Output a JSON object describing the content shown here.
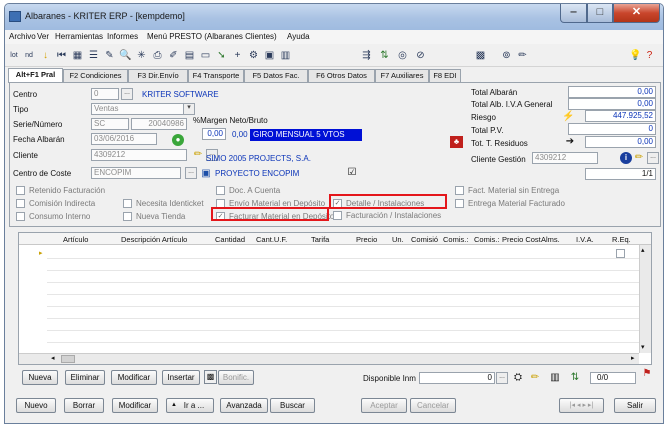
{
  "window": {
    "title": "Albaranes - KRITER ERP - [kempdemo]"
  },
  "menu": [
    "Archivo",
    "Ver",
    "Herramientas",
    "Informes",
    "Menú PRESTO (Albaranes Clientes)",
    "Ayuda"
  ],
  "toolbar": {
    "lot_label": "lot",
    "nd_label": "nd"
  },
  "tabs": [
    "Alt+F1 Pral",
    "F2 Condiciones",
    "F3 Dir.Envío",
    "F4 Transporte",
    "F5 Datos Fac.",
    "F6 Otros Datos",
    "F7 Auxiliares",
    "F8 EDI"
  ],
  "form": {
    "centro_label": "Centro",
    "centro_value": "0",
    "centro_name": "KRITER SOFTWARE",
    "tipo_label": "Tipo",
    "tipo_value": "Ventas",
    "serie_label": "Serie/Número",
    "serie_value": "SC",
    "numero_value": "20040986",
    "margen_label": "%Margen Neto/Bruto",
    "margen_neto": "0,00",
    "margen_bruto": "0,00",
    "forma_pago": "GIRO MENSUAL 5 VTOS",
    "fecha_label": "Fecha Albarán",
    "fecha_value": "03/06/2016",
    "cliente_label": "Cliente",
    "cliente_value": "4309212",
    "cliente_name": "SIMO 2005 PROJECTS, S.A.",
    "coste_label": "Centro de Coste",
    "coste_value": "ENCOPIM",
    "coste_name": "PROYECTO ENCOPIM"
  },
  "totals": {
    "total_albaran_label": "Total Albarán",
    "total_albaran": "0,00",
    "total_iva_label": "Total Alb. I.V.A General",
    "total_iva": "0,00",
    "riesgo_label": "Riesgo",
    "riesgo": "447.925,52",
    "total_pv_label": "Total P.V.",
    "total_pv": "0",
    "residuos_label": "Tot. T. Residuos",
    "residuos": "0,00",
    "gestion_label": "Cliente Gestión",
    "gestion_value": "4309212",
    "counter": "1/1"
  },
  "checkboxes": {
    "retenido": "Retenido Facturación",
    "comision": "Comisión Indirecta",
    "necesita": "Necesita Identicket",
    "consumo": "Consumo Interno",
    "tienda": "Nueva Tienda",
    "doc_cuenta": "Doc. A Cuenta",
    "envio": "Envío Material en Depósito",
    "facturar": "Facturar Material en Depósito",
    "detalle": "Detalle / Instalaciones",
    "fact_instal": "Facturación / Instalaciones",
    "fact_sin": "Fact. Material sin Entrega",
    "entrega_fact": "Entrega Material Facturado",
    "check_mark": "✓"
  },
  "grid": {
    "columns": [
      "Artículo",
      "Descripción Artículo",
      "Cantidad",
      "Cant.U.F.",
      "Tarifa",
      "Precio",
      "Un.",
      "Comisió",
      "Comis.:",
      "Comis.:",
      "Precio Cost",
      "Alms.",
      "I.V.A.",
      "R.Eq."
    ]
  },
  "bottom": {
    "nueva": "Nueva",
    "eliminar": "Eliminar",
    "modificar": "Modificar",
    "insertar": "Insertar",
    "bonific": "Bonific.",
    "disponible_label": "Disponible Inm",
    "disponible_value": "0",
    "page_counter": "0/0"
  },
  "footer": {
    "nuevo": "Nuevo",
    "borrar": "Borrar",
    "modificar": "Modificar",
    "ir_a": "Ir a ...",
    "avanzada": "Avanzada",
    "buscar": "Buscar",
    "aceptar": "Aceptar",
    "cancelar": "Cancelar",
    "salir": "Salir"
  }
}
